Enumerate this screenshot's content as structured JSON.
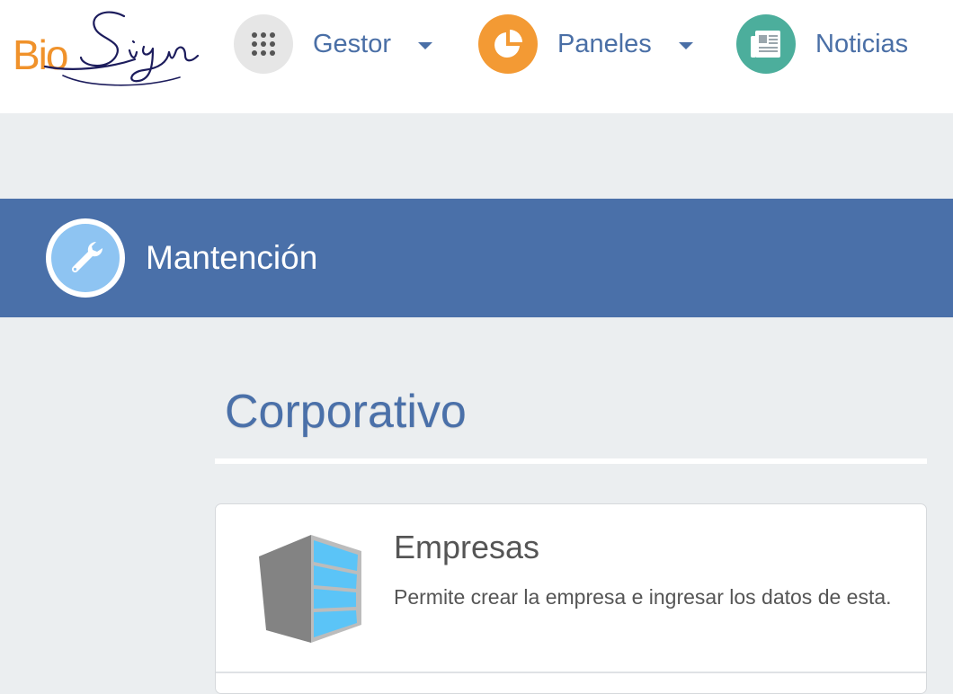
{
  "brand": {
    "logo_bio": "Bio",
    "logo_sign": "Sign",
    "colors": {
      "bio": "#f0922b",
      "sign": "#1c1c5c"
    }
  },
  "nav": {
    "items": [
      {
        "label": "Gestor",
        "icon": "apps-grid-icon",
        "color": "#e6e6e6",
        "dropdown": true
      },
      {
        "label": "Paneles",
        "icon": "pie-chart-icon",
        "color": "#f39a34",
        "dropdown": true
      },
      {
        "label": "Noticias",
        "icon": "newspaper-icon",
        "color": "#4cae9c",
        "dropdown": false
      }
    ]
  },
  "banner": {
    "title": "Mantención",
    "icon": "wrench-icon",
    "color": "#4a70a9"
  },
  "section": {
    "title": "Corporativo"
  },
  "cards": [
    {
      "title": "Empresas",
      "description": "Permite crear la empresa e ingresar los datos de esta.",
      "icon": "building-icon"
    }
  ]
}
